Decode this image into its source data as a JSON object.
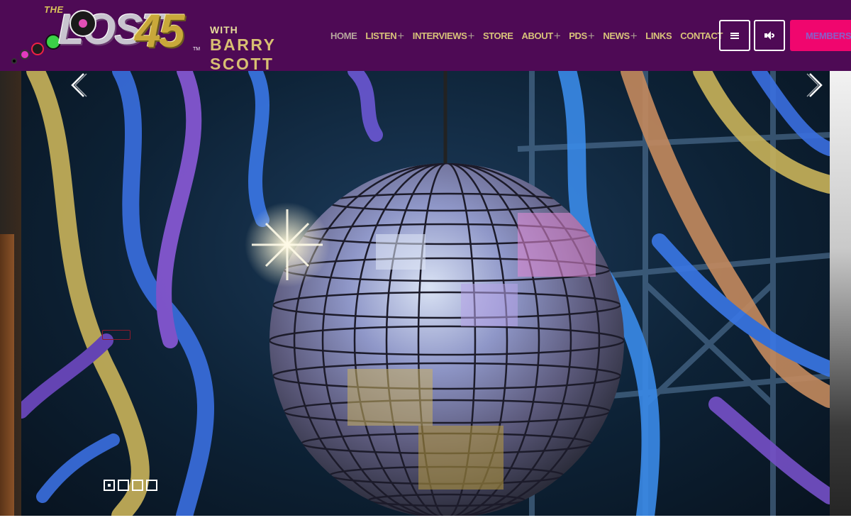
{
  "logo": {
    "the": "THE",
    "lost": "LOST",
    "num": "45",
    "tm": "TM",
    "with": "WITH",
    "host": "BARRY SCOTT"
  },
  "nav": {
    "items": [
      {
        "label": "HOME",
        "has_submenu": false,
        "active": true
      },
      {
        "label": "LISTEN",
        "has_submenu": true
      },
      {
        "label": "INTERVIEWS",
        "has_submenu": true
      },
      {
        "label": "STORE",
        "has_submenu": false
      },
      {
        "label": "ABOUT",
        "has_submenu": true
      },
      {
        "label": "PDS",
        "has_submenu": true
      },
      {
        "label": "NEWS",
        "has_submenu": true
      },
      {
        "label": "LINKS",
        "has_submenu": false
      },
      {
        "label": "CONTACT",
        "has_submenu": false
      }
    ],
    "submenu_glyph": "+"
  },
  "header_buttons": {
    "menu_icon": "hamburger-icon",
    "sound_icon": "speaker-icon",
    "members_label": "MEMBERS"
  },
  "slider": {
    "image": "disco-ball-with-streamers",
    "prev_icon": "chevron-left-icon",
    "next_icon": "chevron-right-icon",
    "slide_count": 4,
    "active_slide": 1
  },
  "colors": {
    "header_bg": "#4e0a55",
    "nav_text": "#d8c27a",
    "members_bg": "#f0066e",
    "members_text": "#8a5ec9"
  }
}
